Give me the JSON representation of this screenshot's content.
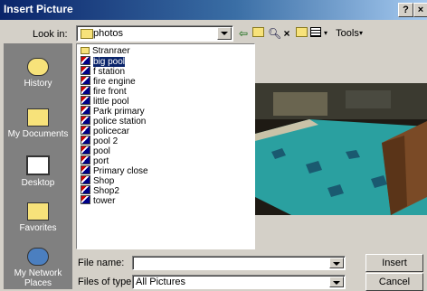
{
  "window": {
    "title": "Insert Picture",
    "help_label": "?",
    "close_label": "×"
  },
  "toolbar": {
    "lookin_label": "Look in:",
    "lookin_value": "photos",
    "back_icon": "back-arrow-icon",
    "up_icon": "up-folder-icon",
    "search_icon": "search-web-icon",
    "delete_label": "×",
    "tools_label": "Tools"
  },
  "places": [
    {
      "label": "History",
      "icon": "history-icon"
    },
    {
      "label": "My Documents",
      "icon": "my-documents-icon"
    },
    {
      "label": "Desktop",
      "icon": "desktop-icon"
    },
    {
      "label": "Favorites",
      "icon": "favorites-icon"
    },
    {
      "label": "My Network Places",
      "icon": "network-places-icon"
    }
  ],
  "files": [
    {
      "name": "Stranraer",
      "type": "folder"
    },
    {
      "name": "big pool",
      "type": "image",
      "selected": true
    },
    {
      "name": "f station",
      "type": "image"
    },
    {
      "name": "fire engine",
      "type": "image"
    },
    {
      "name": "fire front",
      "type": "image"
    },
    {
      "name": "little pool",
      "type": "image"
    },
    {
      "name": "Park primary",
      "type": "image"
    },
    {
      "name": "police station",
      "type": "image"
    },
    {
      "name": "policecar",
      "type": "image"
    },
    {
      "name": "pool 2",
      "type": "image"
    },
    {
      "name": "pool",
      "type": "image"
    },
    {
      "name": "port",
      "type": "image"
    },
    {
      "name": "Primary close",
      "type": "image"
    },
    {
      "name": "Shop",
      "type": "image"
    },
    {
      "name": "Shop2",
      "type": "image"
    },
    {
      "name": "tower",
      "type": "image"
    }
  ],
  "bottom": {
    "filename_label": "File name:",
    "filename_value": "",
    "filetype_label": "Files of type:",
    "filetype_value": "All Pictures",
    "insert_label": "Insert",
    "cancel_label": "Cancel"
  },
  "colors": {
    "selection": "#0a246a",
    "places_bg": "#808080",
    "pool_water": "#2aa0a0"
  }
}
